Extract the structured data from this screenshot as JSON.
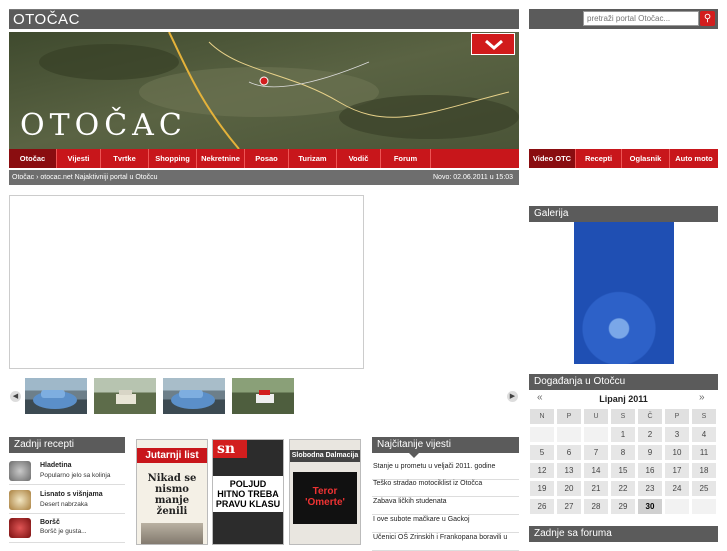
{
  "header": {
    "site_title": "OTOČAC",
    "search_placeholder": "pretraži portal Otočac...",
    "banner_title": "OTOČAC"
  },
  "nav": {
    "items": [
      "Otočac",
      "Vijesti",
      "Tvrtke",
      "Shopping",
      "Nekretnine",
      "Posao",
      "Turizam",
      "Vodič",
      "Forum"
    ],
    "side_items": [
      "Video OTC",
      "Recepti",
      "Oglasnik",
      "Auto moto"
    ]
  },
  "subbar": {
    "breadcrumb": "Otočac › otocac.net Najaktivniji portal u Otočcu",
    "date_label": "Novo: 02.06.2011  u  15:03"
  },
  "gallery": {
    "title": "Galerija"
  },
  "events": {
    "title": "Događanja u Otočcu",
    "month": "Lipanj 2011",
    "prev": "«",
    "next": "»",
    "weekdays": [
      "N",
      "P",
      "U",
      "S",
      "Č",
      "P",
      "S"
    ],
    "days": [
      "",
      "",
      "",
      "1",
      "2",
      "3",
      "4",
      "5",
      "6",
      "7",
      "8",
      "9",
      "10",
      "11",
      "12",
      "13",
      "14",
      "15",
      "16",
      "17",
      "18",
      "19",
      "20",
      "21",
      "22",
      "23",
      "24",
      "25",
      "26",
      "27",
      "28",
      "29",
      "30",
      "",
      ""
    ],
    "today": "30"
  },
  "recipes": {
    "title": "Zadnji recepti",
    "items": [
      {
        "title": "Hladetina",
        "desc": "Popularno jelo sa kolinja"
      },
      {
        "title": "Lisnato s višnjama",
        "desc": "Desert nabrzaka"
      },
      {
        "title": "Boršč",
        "desc": "Boršč je gusta..."
      }
    ]
  },
  "newspapers": {
    "items": [
      {
        "name": "Jutarnji list",
        "headline": "Nikad se nismo manje ženili"
      },
      {
        "name": "sn",
        "headline": "POLJUD HITNO TREBA PRAVU KLASU"
      },
      {
        "name": "Slobodna Dalmacija",
        "headline": "Teror 'Omerte'"
      }
    ]
  },
  "most_read": {
    "title": "Najčitanije vijesti",
    "items": [
      "Stanje u prometu u veljači 2011. godine",
      "Teško stradao motociklist iz Otočca",
      "Zabava ličkih studenata",
      "I ove subote mačkare u Gackoj",
      "Učenici OŠ Zrinskih i Frankopana boravili u"
    ]
  },
  "forum": {
    "title": "Zadnje sa foruma"
  },
  "colors": {
    "accent": "#c8161b",
    "header_gray": "#5b5b5b"
  }
}
